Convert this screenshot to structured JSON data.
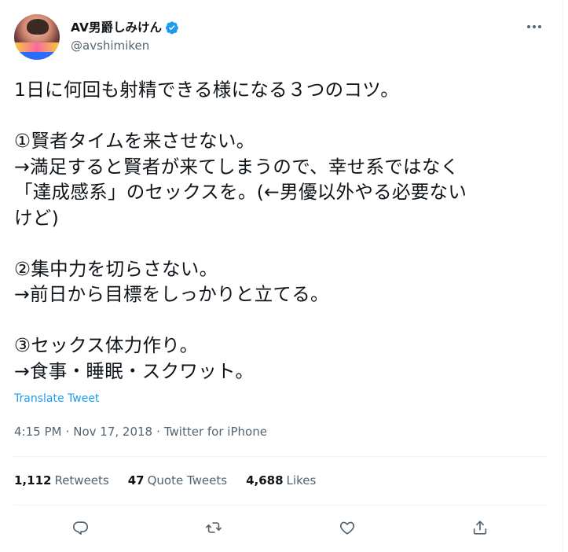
{
  "user": {
    "display_name": "AV男爵しみけん",
    "handle": "@avshimiken",
    "verified": true,
    "avatar_icon": "avatar-photo"
  },
  "tweet": {
    "text": "1日に何回も射精できる様になる３つのコツ。\n\n①賢者タイムを来させない。\n→満足すると賢者が来てしまうので、幸せ系ではなく\n「達成感系」のセックスを。(←男優以外やる必要ない\nけど)\n\n②集中力を切らさない。\n→前日から目標をしっかりと立てる。\n\n③セックス体力作り。\n→食事・睡眠・スクワット。",
    "translate_label": "Translate Tweet",
    "time": "4:15 PM",
    "date": "Nov 17, 2018",
    "source": "Twitter for iPhone",
    "separator": "·"
  },
  "stats": {
    "retweets_count": "1,112",
    "retweets_label": "Retweets",
    "quote_count": "47",
    "quote_label": "Quote Tweets",
    "likes_count": "4,688",
    "likes_label": "Likes"
  },
  "actions": [
    {
      "icon": "reply-icon"
    },
    {
      "icon": "retweet-icon"
    },
    {
      "icon": "like-icon"
    },
    {
      "icon": "share-icon"
    }
  ],
  "colors": {
    "accent": "#1d9bf0",
    "text": "#0f1419",
    "secondary": "#536471",
    "divider": "#eff3f4"
  }
}
